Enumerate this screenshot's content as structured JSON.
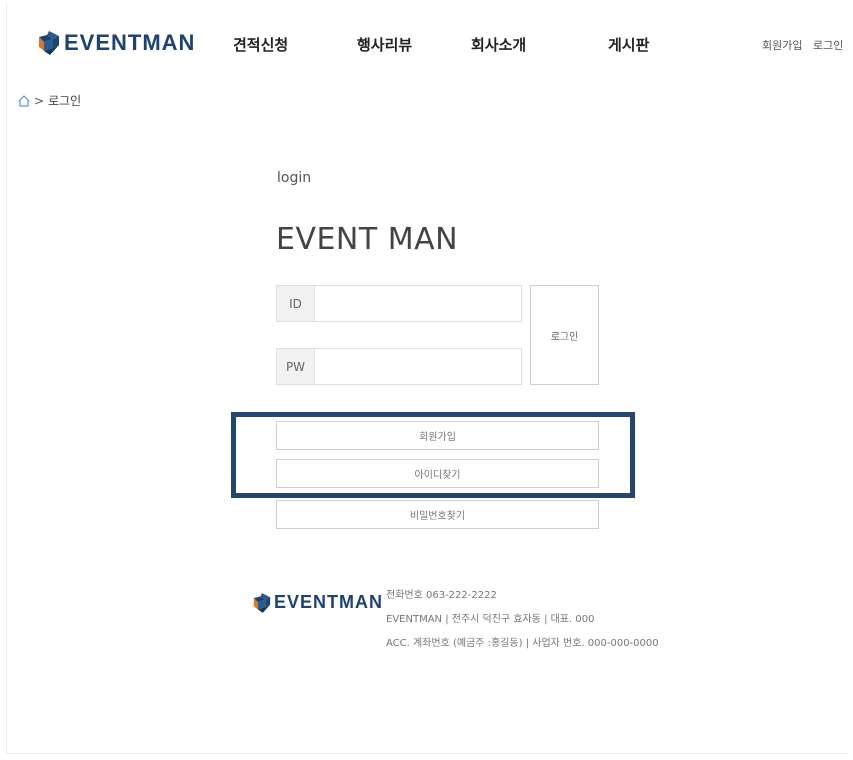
{
  "header": {
    "logo_text": "EVENTMAN",
    "nav": [
      "견적신청",
      "행사리뷰",
      "회사소개",
      "게시판"
    ],
    "signup_link": "회원가입",
    "login_link": "로그인"
  },
  "breadcrumb": {
    "separator": ">",
    "current": "로그인"
  },
  "login": {
    "label": "login",
    "title": "EVENT MAN",
    "id_prefix": "ID",
    "id_value": "",
    "pw_prefix": "PW",
    "pw_value": "",
    "submit_label": "로그인",
    "signup_label": "회원가입",
    "find_id_label": "아이디찾기",
    "find_pw_label": "비밀번호찾기"
  },
  "footer": {
    "logo_text": "EVENTMAN",
    "phone": "전화번호 063-222-2222",
    "address": "EVENTMAN | 전주시 덕진구 효자동 | 대표. 000",
    "account": "ACC. 계좌번호 (예금주 :홍길동) | 사업자 번호. 000-000-0000"
  },
  "colors": {
    "brand": "#1e4272",
    "highlight": "#24466f"
  },
  "icons": {
    "logo": "eventman-logo-icon",
    "home": "home-icon"
  }
}
